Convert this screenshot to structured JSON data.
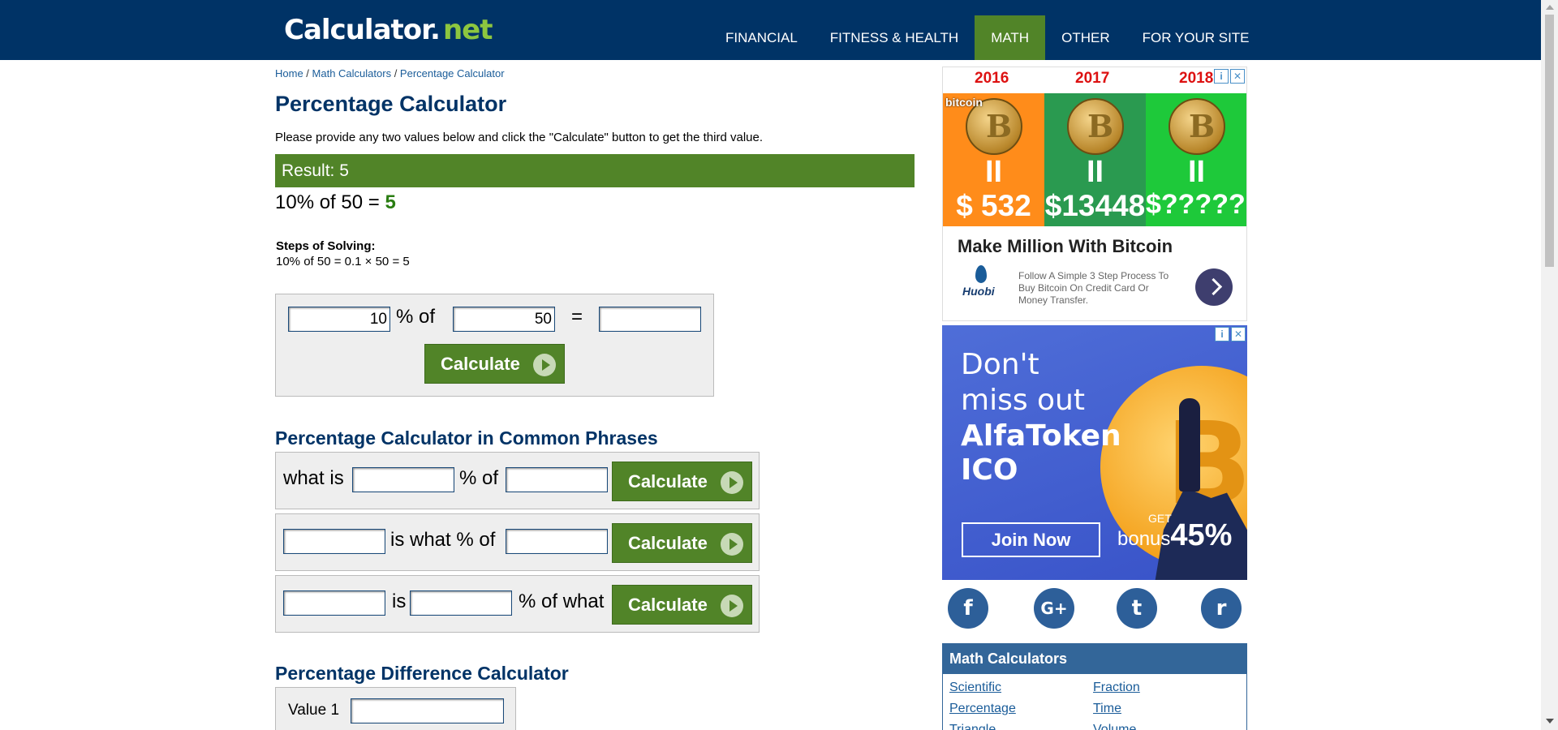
{
  "header": {
    "logo_main": "Calculator",
    "logo_dot": ".",
    "logo_net": "net",
    "nav": [
      "FINANCIAL",
      "FITNESS & HEALTH",
      "MATH",
      "OTHER",
      "FOR YOUR SITE"
    ],
    "active_nav": "MATH"
  },
  "breadcrumb": {
    "home": "Home",
    "sep": " / ",
    "math": "Math Calculators",
    "current": "Percentage Calculator"
  },
  "page_title": "Percentage Calculator",
  "instructions": "Please provide any two values below and click the \"Calculate\" button to get the third value.",
  "result": {
    "bar": "Result: 5",
    "equation_prefix": "10% of 50 = ",
    "answer": "5",
    "steps_title": "Steps of Solving:",
    "steps_line": "10% of 50 = 0.1 × 50 = 5"
  },
  "main_calc": {
    "value1": "10",
    "label_pct_of": "% of",
    "value2": "50",
    "label_eq": "=",
    "value3": "",
    "button": "Calculate"
  },
  "common_phrases": {
    "title": "Percentage Calculator in Common Phrases",
    "row1": {
      "label_a": "what is",
      "label_b": "% of",
      "button": "Calculate"
    },
    "row2": {
      "label_a": "is what % of",
      "button": "Calculate"
    },
    "row3": {
      "label_a": "is",
      "label_b": "% of what",
      "button": "Calculate"
    }
  },
  "difference": {
    "title": "Percentage Difference Calculator",
    "value1_label": "Value 1"
  },
  "ad1": {
    "years": [
      "2016",
      "2017",
      "2018"
    ],
    "prices": [
      "$ 532",
      "$13448",
      "$??????"
    ],
    "eq_sign": "II",
    "bitcoin_word": "bitcoin",
    "headline": "Make Million With Bitcoin",
    "brand": "Huobi",
    "description": "Follow A Simple 3 Step Process To Buy Bitcoin On Credit Card Or Money Transfer.",
    "colors": [
      "#ff8c1a",
      "#2a9a50",
      "#1ec93a"
    ]
  },
  "ad2": {
    "line1": "Don't",
    "line2": "miss out",
    "line3": "AlfaToken",
    "line4": "ICO",
    "join": "Join Now",
    "get": "GET",
    "bonus": "bonus",
    "pct": "45%"
  },
  "social": [
    "f",
    "G+",
    "t",
    "r"
  ],
  "side_panel": {
    "title": "Math Calculators",
    "links_left": [
      "Scientific",
      "Percentage",
      "Triangle"
    ],
    "links_right": [
      "Fraction",
      "Time",
      "Volume"
    ]
  },
  "ad_badges": {
    "info": "i",
    "close": "✕"
  }
}
